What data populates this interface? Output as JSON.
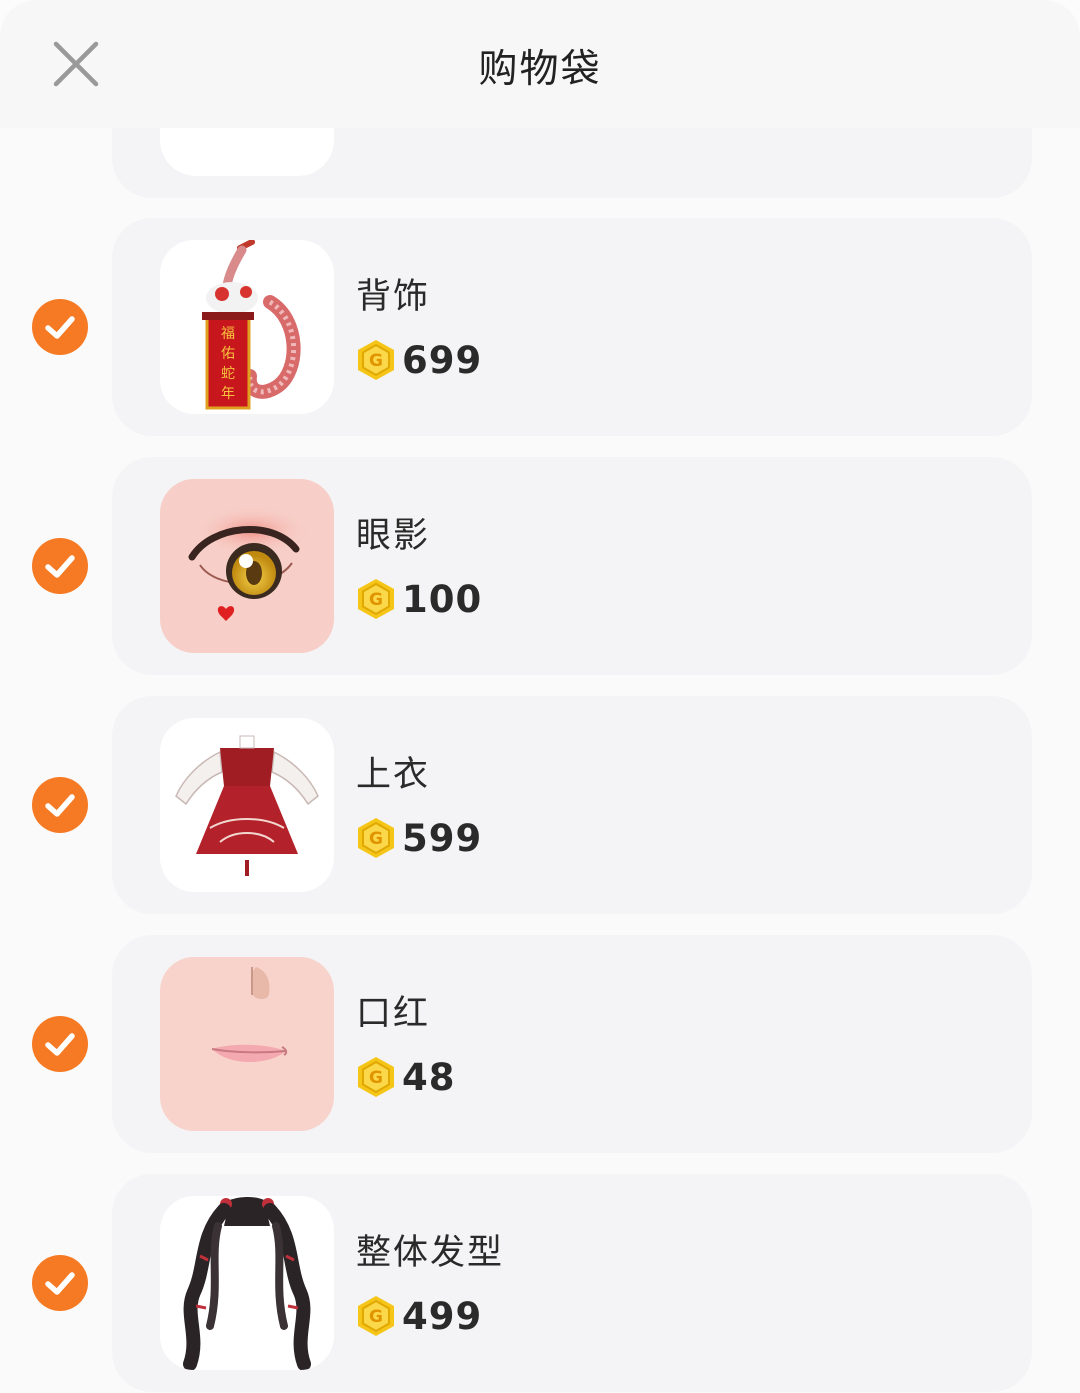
{
  "header": {
    "title": "购物袋"
  },
  "items": [
    {
      "name": "背饰",
      "price": "699",
      "selected": true,
      "thumb": "snake-charm-accessory"
    },
    {
      "name": "眼影",
      "price": "100",
      "selected": true,
      "thumb": "eye-shadow"
    },
    {
      "name": "上衣",
      "price": "599",
      "selected": true,
      "thumb": "red-dress"
    },
    {
      "name": "口红",
      "price": "48",
      "selected": true,
      "thumb": "lipstick"
    },
    {
      "name": "整体发型",
      "price": "499",
      "selected": true,
      "thumb": "twin-tail-hairstyle"
    }
  ],
  "colors": {
    "check": "#f57a23",
    "coin": "#f5c518",
    "card": "#f4f4f6"
  },
  "icons": {
    "close": "close-icon",
    "check": "checkmark-icon",
    "coin": "gold-coin-icon"
  },
  "thumb_art": {
    "charm_text": "福佑蛇年"
  }
}
